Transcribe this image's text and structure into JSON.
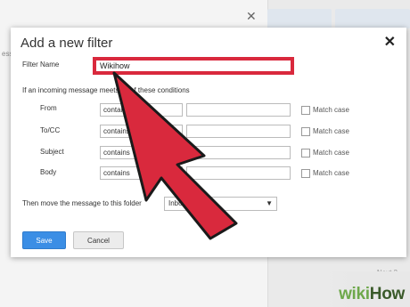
{
  "background": {
    "hint_text": "essa",
    "close_glyph": "✕",
    "footer_text": "Next 2"
  },
  "dialog": {
    "title": "Add a new filter",
    "close_glyph": "✕",
    "filter_name_label": "Filter Name",
    "filter_name_value": "Wikihow",
    "conditions_intro": "If an incoming message meets all of these conditions",
    "conditions": [
      {
        "label": "From",
        "operator": "contains",
        "value": "",
        "match_case_label": "Match case",
        "match_case_checked": false
      },
      {
        "label": "To/CC",
        "operator": "contains",
        "value": "",
        "match_case_label": "Match case",
        "match_case_checked": false
      },
      {
        "label": "Subject",
        "operator": "contains",
        "value": "",
        "match_case_label": "Match case",
        "match_case_checked": false
      },
      {
        "label": "Body",
        "operator": "contains",
        "value": "",
        "match_case_label": "Match case",
        "match_case_checked": false
      }
    ],
    "move_label": "Then move the message to this folder",
    "folder_value": "Inbox",
    "save_label": "Save",
    "cancel_label": "Cancel"
  },
  "overlay": {
    "arrow_color": "#d9293d"
  },
  "watermark": {
    "part1": "wiki",
    "part2": "How"
  },
  "colors": {
    "highlight": "#d9293d",
    "primary_button": "#3b8ee5"
  }
}
